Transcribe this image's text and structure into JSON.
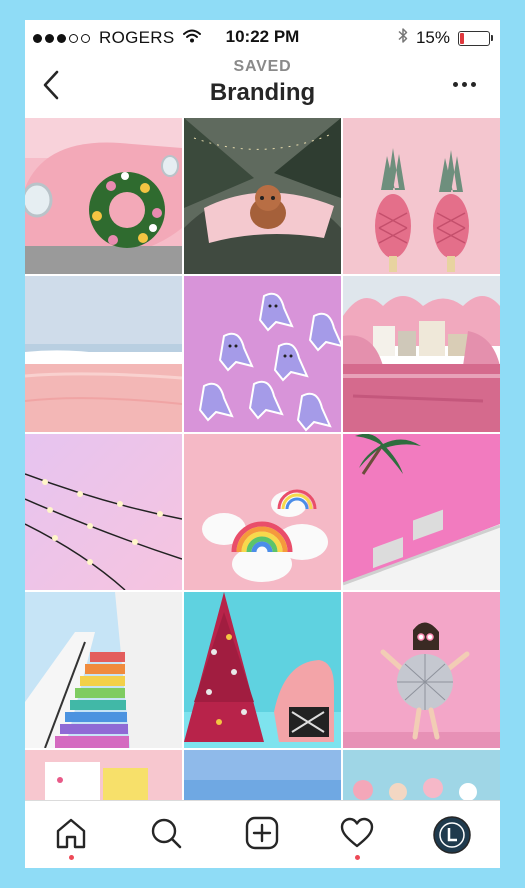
{
  "status_bar": {
    "carrier": "ROGERS",
    "time": "10:22 PM",
    "battery_percent_label": "15%",
    "battery_level": 0.15,
    "icons": [
      "signal-dots-icon",
      "wifi-icon",
      "bluetooth-icon",
      "battery-icon"
    ]
  },
  "header": {
    "subtitle": "SAVED",
    "title": "Branding",
    "icons": [
      "back-chevron-icon",
      "more-options-icon"
    ]
  },
  "grid": {
    "columns": 3,
    "tiles": [
      "pink-car-wreath",
      "dog-on-pink-blanket",
      "pink-pineapples",
      "pink-beach",
      "ghost-cookies",
      "pink-river-town",
      "string-lights-pink-sky",
      "rainbow-pumpkins",
      "palm-pink-building",
      "rainbow-stairs",
      "pink-christmas-tree",
      "disco-ball-costume",
      "cards-partial",
      "blue-sky-partial",
      "balloons-partial"
    ]
  },
  "tab_bar": {
    "items": [
      "home-icon",
      "search-icon",
      "add-post-icon",
      "activity-heart-icon",
      "profile-avatar-icon"
    ],
    "notification_color": "#ed4956"
  },
  "colors": {
    "frame_background": "#8fdcf6",
    "battery_low": "#e0393e"
  }
}
